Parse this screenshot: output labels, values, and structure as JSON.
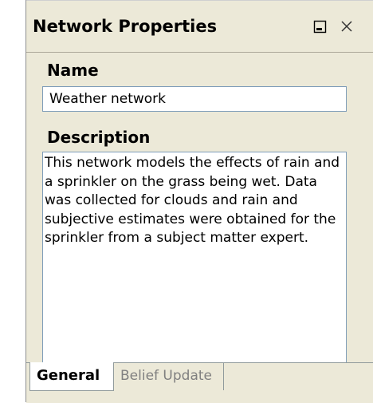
{
  "panel": {
    "title": "Network Properties",
    "buttons": {
      "restore": "restore-icon",
      "close": "close-icon"
    }
  },
  "form": {
    "name_label": "Name",
    "name_value": "Weather network",
    "description_label": "Description",
    "description_value": "This network models the effects of rain and a sprinkler on the grass being wet. Data was collected for clouds and rain and subjective estimates were obtained for the sprinkler from a subject matter expert."
  },
  "tabs": [
    {
      "label": "General",
      "active": true
    },
    {
      "label": "Belief Update",
      "active": false
    }
  ],
  "colors": {
    "panel_bg": "#ece9d8",
    "input_border": "#7f9db9",
    "inactive_tab_text": "#808080"
  }
}
